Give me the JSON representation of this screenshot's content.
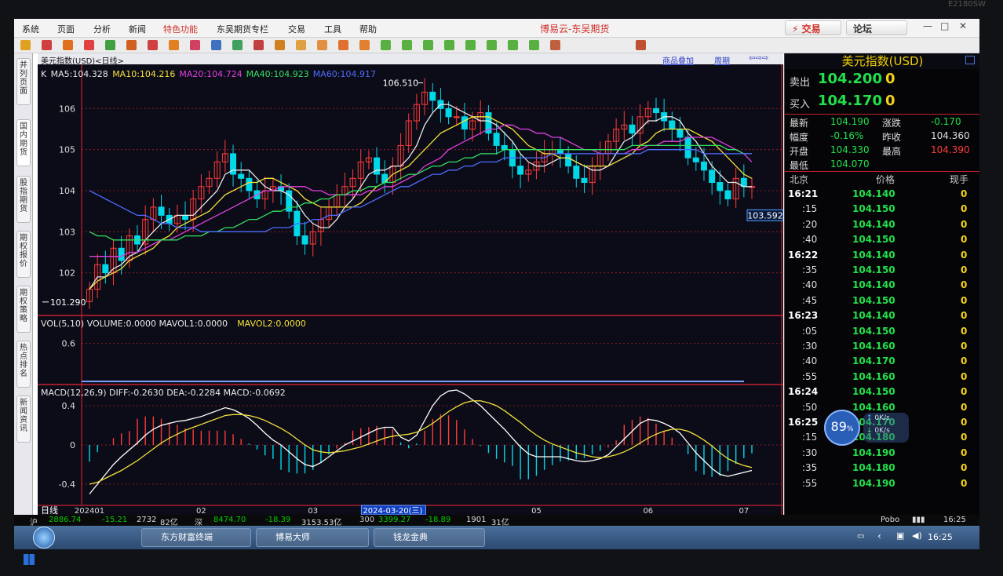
{
  "app": {
    "menu": [
      "系统",
      "页面",
      "分析",
      "新闻",
      "特色功能",
      "东吴期货专栏",
      "交易",
      "工具",
      "帮助"
    ],
    "title": "博易云-东吴期货",
    "trade_btn": "⚡ 交易",
    "forum_btn": "论坛",
    "monitor_brand": "E2180SW",
    "side_tabs": [
      "并列页面",
      "国内期货",
      "股指期货",
      "期权报价",
      "期权策略",
      "热点排名",
      "新闻资讯"
    ],
    "header": {
      "name": "美元指数(USD)<日线>",
      "overlay": "商品叠加",
      "period": "周期"
    }
  },
  "chart_data": {
    "type": "candlestick",
    "symbol": "美元指数(USD)",
    "period_label": "日线",
    "price_panel": {
      "ma_labels": [
        {
          "text": "K",
          "color": "#e8e8e8"
        },
        {
          "text": "MA5:104.328",
          "color": "#e8e8e8"
        },
        {
          "text": "MA10:104.216",
          "color": "#f3e13b"
        },
        {
          "text": "MA20:104.724",
          "color": "#e040e0"
        },
        {
          "text": "MA40:104.923",
          "color": "#33e060"
        },
        {
          "text": "MA60:104.917",
          "color": "#4d6cff"
        }
      ],
      "y_ticks": [
        "106",
        "105",
        "104",
        "103",
        "102"
      ],
      "y_tick_values": [
        106,
        105,
        104,
        103,
        102
      ],
      "y_range": [
        101.0,
        107.0
      ],
      "high_label": "106.510",
      "low_label": "101.290",
      "last_price_tag": "103.592",
      "closes": [
        101.6,
        102.2,
        102.0,
        102.6,
        102.3,
        102.9,
        102.7,
        103.3,
        103.6,
        103.4,
        103.2,
        103.4,
        103.3,
        103.8,
        104.1,
        104.3,
        104.7,
        104.9,
        104.4,
        104.3,
        104.0,
        103.8,
        104.0,
        104.1,
        104.0,
        103.5,
        102.9,
        102.7,
        103.0,
        103.3,
        103.6,
        103.9,
        104.1,
        104.3,
        104.7,
        104.8,
        104.4,
        104.2,
        104.6,
        105.1,
        105.7,
        106.1,
        106.4,
        106.2,
        106.0,
        105.8,
        105.8,
        105.5,
        105.7,
        105.9,
        105.4,
        105.1,
        105.0,
        104.6,
        104.4,
        104.5,
        104.7,
        104.9,
        105.0,
        104.9,
        104.6,
        104.3,
        104.2,
        104.6,
        104.9,
        105.2,
        105.5,
        105.6,
        105.4,
        105.8,
        106.0,
        105.9,
        105.7,
        105.5,
        105.3,
        104.8,
        104.7,
        104.5,
        104.2,
        104.0,
        103.8,
        104.3,
        104.1,
        104.1
      ],
      "ma_lines": {
        "MA5": [
          101.6,
          101.9,
          101.9,
          102.1,
          102.2,
          102.4,
          102.5,
          102.8,
          103.0,
          103.2,
          103.3,
          103.4,
          103.4,
          103.4,
          103.6,
          103.8,
          104.0,
          104.4,
          104.5,
          104.5,
          104.5,
          104.3,
          104.1,
          104.0,
          104.0,
          103.9,
          103.7,
          103.4,
          103.2,
          103.1,
          103.1,
          103.3,
          103.6,
          103.8,
          104.1,
          104.4,
          104.5,
          104.5,
          104.6,
          104.6,
          104.8,
          105.1,
          105.6,
          105.9,
          106.1,
          106.1,
          106.0,
          105.9,
          105.8,
          105.7,
          105.7,
          105.6,
          105.4,
          105.2,
          104.9,
          104.7,
          104.6,
          104.6,
          104.7,
          104.8,
          104.8,
          104.7,
          104.6,
          104.5,
          104.5,
          104.6,
          104.9,
          105.2,
          105.3,
          105.5,
          105.7,
          105.7,
          105.8,
          105.8,
          105.7,
          105.4,
          105.2,
          104.9,
          104.6,
          104.4,
          104.2,
          104.2,
          104.1,
          104.1
        ],
        "MA10": [
          101.6,
          101.8,
          101.9,
          102.0,
          102.1,
          102.3,
          102.4,
          102.5,
          102.6,
          102.8,
          102.9,
          103.1,
          103.2,
          103.3,
          103.4,
          103.5,
          103.7,
          103.9,
          104.0,
          104.1,
          104.2,
          104.2,
          104.3,
          104.3,
          104.2,
          104.1,
          104.0,
          103.8,
          103.7,
          103.6,
          103.6,
          103.6,
          103.6,
          103.6,
          103.7,
          103.9,
          104.1,
          104.2,
          104.4,
          104.5,
          104.6,
          104.8,
          105.0,
          105.2,
          105.4,
          105.5,
          105.6,
          105.7,
          105.8,
          105.8,
          105.8,
          105.7,
          105.6,
          105.5,
          105.3,
          105.1,
          105.0,
          104.9,
          104.9,
          104.8,
          104.8,
          104.7,
          104.6,
          104.6,
          104.6,
          104.6,
          104.7,
          104.8,
          104.9,
          105.1,
          105.2,
          105.4,
          105.5,
          105.5,
          105.5,
          105.5,
          105.4,
          105.3,
          105.2,
          105.0,
          104.8,
          104.6,
          104.4,
          104.3
        ],
        "MA20": [
          102.4,
          102.4,
          102.4,
          102.4,
          102.4,
          102.5,
          102.5,
          102.6,
          102.7,
          102.8,
          102.8,
          102.9,
          103.0,
          103.1,
          103.2,
          103.3,
          103.4,
          103.5,
          103.6,
          103.7,
          103.8,
          103.9,
          104.0,
          104.0,
          104.1,
          104.1,
          104.1,
          104.1,
          104.0,
          104.0,
          103.9,
          103.9,
          103.9,
          103.9,
          103.9,
          104.0,
          104.0,
          104.1,
          104.1,
          104.2,
          104.3,
          104.4,
          104.6,
          104.7,
          104.8,
          105.0,
          105.1,
          105.2,
          105.3,
          105.4,
          105.5,
          105.5,
          105.6,
          105.6,
          105.5,
          105.5,
          105.4,
          105.4,
          105.3,
          105.3,
          105.2,
          105.1,
          105.0,
          105.0,
          104.9,
          104.9,
          104.9,
          104.9,
          105.0,
          105.0,
          105.1,
          105.1,
          105.2,
          105.2,
          105.2,
          105.3,
          105.3,
          105.3,
          105.3,
          105.2,
          105.1,
          105.0,
          104.9,
          104.7
        ],
        "MA40": [
          103.0,
          102.9,
          102.9,
          102.8,
          102.8,
          102.8,
          102.8,
          102.8,
          102.8,
          102.8,
          102.8,
          102.8,
          102.9,
          102.9,
          102.9,
          103.0,
          103.0,
          103.1,
          103.1,
          103.2,
          103.3,
          103.3,
          103.4,
          103.5,
          103.5,
          103.6,
          103.6,
          103.7,
          103.7,
          103.8,
          103.8,
          103.9,
          103.9,
          104.0,
          104.0,
          104.1,
          104.1,
          104.2,
          104.2,
          104.3,
          104.4,
          104.4,
          104.5,
          104.6,
          104.6,
          104.7,
          104.7,
          104.8,
          104.8,
          104.9,
          104.9,
          104.9,
          105.0,
          105.0,
          105.0,
          105.0,
          105.0,
          105.0,
          105.0,
          105.0,
          105.0,
          105.0,
          105.0,
          105.0,
          105.0,
          105.0,
          105.0,
          105.0,
          105.1,
          105.1,
          105.1,
          105.1,
          105.1,
          105.1,
          105.1,
          105.1,
          105.1,
          105.1,
          105.1,
          105.1,
          105.0,
          105.0,
          104.9,
          104.9
        ],
        "MA60": [
          104.0,
          103.9,
          103.8,
          103.7,
          103.6,
          103.5,
          103.4,
          103.4,
          103.3,
          103.2,
          103.2,
          103.1,
          103.1,
          103.1,
          103.0,
          103.0,
          103.0,
          103.0,
          103.0,
          103.0,
          103.0,
          103.0,
          103.0,
          103.1,
          103.1,
          103.1,
          103.2,
          103.2,
          103.3,
          103.3,
          103.4,
          103.4,
          103.5,
          103.6,
          103.6,
          103.7,
          103.8,
          103.9,
          104.0,
          104.1,
          104.1,
          104.2,
          104.3,
          104.4,
          104.4,
          104.5,
          104.5,
          104.6,
          104.6,
          104.7,
          104.7,
          104.7,
          104.8,
          104.8,
          104.8,
          104.8,
          104.8,
          104.8,
          104.9,
          104.9,
          104.9,
          104.9,
          104.9,
          104.9,
          104.9,
          104.9,
          104.9,
          104.9,
          104.9,
          104.9,
          105.0,
          105.0,
          105.0,
          105.0,
          105.0,
          105.0,
          105.0,
          104.9,
          104.9,
          104.9,
          104.9,
          104.9,
          104.9,
          104.9
        ]
      }
    },
    "volume_panel": {
      "label": "VOL(5,10) VOLUME:0.0000 MAVOL1:0.0000",
      "label2": "MAVOL2:0.0000",
      "y_ticks": [
        "0.6"
      ],
      "y_tick_values": [
        0.6
      ],
      "y_range": [
        0,
        1.0
      ]
    },
    "macd_panel": {
      "label": "MACD(12,26,9) DIFF:-0.2630 DEA:-0.2284 MACD:-0.0692",
      "y_ticks": [
        "0.4",
        "0",
        "-0.4"
      ],
      "y_tick_values": [
        0.4,
        0,
        -0.4
      ],
      "y_range": [
        -0.6,
        0.6
      ],
      "diff": [
        -0.5,
        -0.4,
        -0.3,
        -0.2,
        -0.12,
        -0.05,
        0.02,
        0.1,
        0.16,
        0.2,
        0.22,
        0.24,
        0.25,
        0.27,
        0.29,
        0.32,
        0.35,
        0.38,
        0.36,
        0.32,
        0.27,
        0.2,
        0.12,
        0.05,
        0.0,
        -0.07,
        -0.14,
        -0.2,
        -0.22,
        -0.18,
        -0.12,
        -0.06,
        0.0,
        0.04,
        0.08,
        0.12,
        0.16,
        0.18,
        0.18,
        0.08,
        0.04,
        0.1,
        0.25,
        0.4,
        0.5,
        0.55,
        0.56,
        0.52,
        0.46,
        0.4,
        0.32,
        0.24,
        0.16,
        0.07,
        -0.02,
        -0.09,
        -0.12,
        -0.12,
        -0.12,
        -0.12,
        -0.14,
        -0.16,
        -0.17,
        -0.16,
        -0.14,
        -0.1,
        -0.02,
        0.06,
        0.14,
        0.22,
        0.26,
        0.25,
        0.22,
        0.18,
        0.12,
        0.02,
        -0.08,
        -0.16,
        -0.24,
        -0.3,
        -0.32,
        -0.3,
        -0.28,
        -0.26
      ],
      "dea": [
        -0.4,
        -0.38,
        -0.34,
        -0.3,
        -0.26,
        -0.21,
        -0.16,
        -0.1,
        -0.04,
        0.02,
        0.07,
        0.11,
        0.15,
        0.18,
        0.21,
        0.24,
        0.27,
        0.3,
        0.31,
        0.31,
        0.3,
        0.28,
        0.25,
        0.21,
        0.17,
        0.12,
        0.06,
        0.0,
        -0.05,
        -0.07,
        -0.08,
        -0.07,
        -0.06,
        -0.04,
        -0.02,
        0.01,
        0.04,
        0.07,
        0.09,
        0.1,
        0.11,
        0.13,
        0.17,
        0.22,
        0.28,
        0.34,
        0.39,
        0.43,
        0.45,
        0.45,
        0.43,
        0.4,
        0.35,
        0.29,
        0.23,
        0.16,
        0.1,
        0.05,
        0.01,
        -0.02,
        -0.05,
        -0.08,
        -0.1,
        -0.12,
        -0.13,
        -0.12,
        -0.1,
        -0.07,
        -0.03,
        0.02,
        0.07,
        0.11,
        0.14,
        0.16,
        0.16,
        0.14,
        0.1,
        0.05,
        -0.01,
        -0.08,
        -0.14,
        -0.18,
        -0.21,
        -0.23
      ]
    },
    "x_ticks": [
      {
        "i": 0,
        "label": "202401"
      },
      {
        "i": 14,
        "label": "02"
      },
      {
        "i": 28,
        "label": "03"
      },
      {
        "i": 38,
        "label": "2024-03-20(三)"
      },
      {
        "i": 56,
        "label": "05"
      },
      {
        "i": 70,
        "label": "06"
      },
      {
        "i": 82,
        "label": "07"
      }
    ],
    "x_axis_label": "日线"
  },
  "quote": {
    "title": "美元指数(USD)",
    "sell_label": "卖出",
    "sell_price": "104.200",
    "sell_qty": "0",
    "buy_label": "买入",
    "buy_price": "104.170",
    "buy_qty": "0",
    "stats": [
      {
        "k": "最新",
        "v": "104.190",
        "k2": "涨跌",
        "v2": "-0.170"
      },
      {
        "k": "幅度",
        "v": "-0.16%",
        "k2": "昨收",
        "v2": "104.360"
      },
      {
        "k": "开盘",
        "v": "104.330",
        "k2": "最高",
        "v2": "104.390"
      },
      {
        "k": "最低",
        "v": "104.070",
        "k2": "",
        "v2": ""
      }
    ],
    "ticks_header": {
      "time": "北京",
      "price": "价格",
      "vol": "现手"
    },
    "ticks": [
      {
        "t": "16:21",
        "p": "104.140",
        "v": "0"
      },
      {
        "t": ":15",
        "p": "104.150",
        "v": "0"
      },
      {
        "t": ":20",
        "p": "104.140",
        "v": "0"
      },
      {
        "t": ":40",
        "p": "104.150",
        "v": "0"
      },
      {
        "t": "16:22",
        "p": "104.140",
        "v": "0"
      },
      {
        "t": ":35",
        "p": "104.150",
        "v": "0"
      },
      {
        "t": ":40",
        "p": "104.140",
        "v": "0"
      },
      {
        "t": ":45",
        "p": "104.150",
        "v": "0"
      },
      {
        "t": "16:23",
        "p": "104.140",
        "v": "0"
      },
      {
        "t": ":05",
        "p": "104.150",
        "v": "0"
      },
      {
        "t": ":30",
        "p": "104.160",
        "v": "0"
      },
      {
        "t": ":40",
        "p": "104.170",
        "v": "0"
      },
      {
        "t": ":55",
        "p": "104.160",
        "v": "0"
      },
      {
        "t": "16:24",
        "p": "104.150",
        "v": "0"
      },
      {
        "t": ":50",
        "p": "104.160",
        "v": "0"
      },
      {
        "t": "16:25",
        "p": "104.170",
        "v": "0"
      },
      {
        "t": ":15",
        "p": "104.180",
        "v": "0"
      },
      {
        "t": ":30",
        "p": "104.190",
        "v": "0"
      },
      {
        "t": ":35",
        "p": "104.180",
        "v": "0"
      },
      {
        "t": ":55",
        "p": "104.190",
        "v": "0"
      }
    ],
    "gauge": {
      "percent": "89",
      "unit": "%",
      "up": "0K/s",
      "down": "0K/s"
    }
  },
  "statusbar": {
    "items": [
      "沪",
      "2886.74",
      "-15.21",
      "2732",
      "82亿",
      "深",
      "8474.70",
      "-18.39",
      "3153.53亿",
      "300",
      "3399.27",
      "-18.89",
      "1901",
      "31亿"
    ],
    "pobo": "Pobo",
    "time": "16:25"
  },
  "taskbar": {
    "apps": [
      "东方财富终端",
      "博易大师",
      "钱龙金典"
    ],
    "clock": "16:25"
  },
  "colors": {
    "up": "#ff3b3b",
    "down": "#00d8e8",
    "grid": "#a0202a",
    "label": "#dcdcdc",
    "bg": "#0c0c18"
  }
}
